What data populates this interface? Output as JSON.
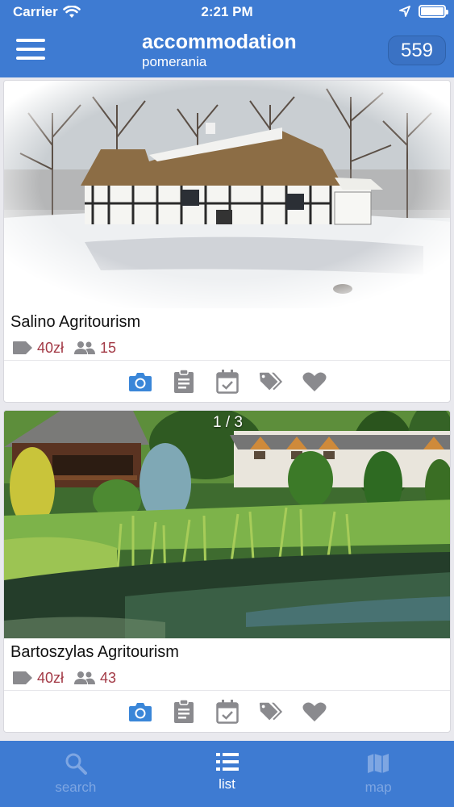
{
  "status_bar": {
    "carrier": "Carrier",
    "time": "2:21 PM",
    "battery_level": 1.0
  },
  "header": {
    "title": "accommodation",
    "subtitle": "pomerania",
    "count": "559"
  },
  "listings": [
    {
      "name": "Salino Agritourism",
      "price": "40zł",
      "capacity": "15",
      "image_counter": ""
    },
    {
      "name": "Bartoszylas Agritourism",
      "price": "40zł",
      "capacity": "43",
      "image_counter": "1 / 3"
    }
  ],
  "actions": [
    "camera-icon",
    "clipboard-icon",
    "calendar-check-icon",
    "tags-icon",
    "heart-icon"
  ],
  "tabs": [
    {
      "label": "search",
      "icon": "search-icon",
      "active": false
    },
    {
      "label": "list",
      "icon": "list-icon",
      "active": true
    },
    {
      "label": "map",
      "icon": "map-icon",
      "active": false
    }
  ],
  "colors": {
    "brand_blue": "#3e7bd2",
    "accent_blue": "#3a86d8",
    "meta_red": "#a33a46",
    "icon_gray": "#8a8a8e"
  }
}
